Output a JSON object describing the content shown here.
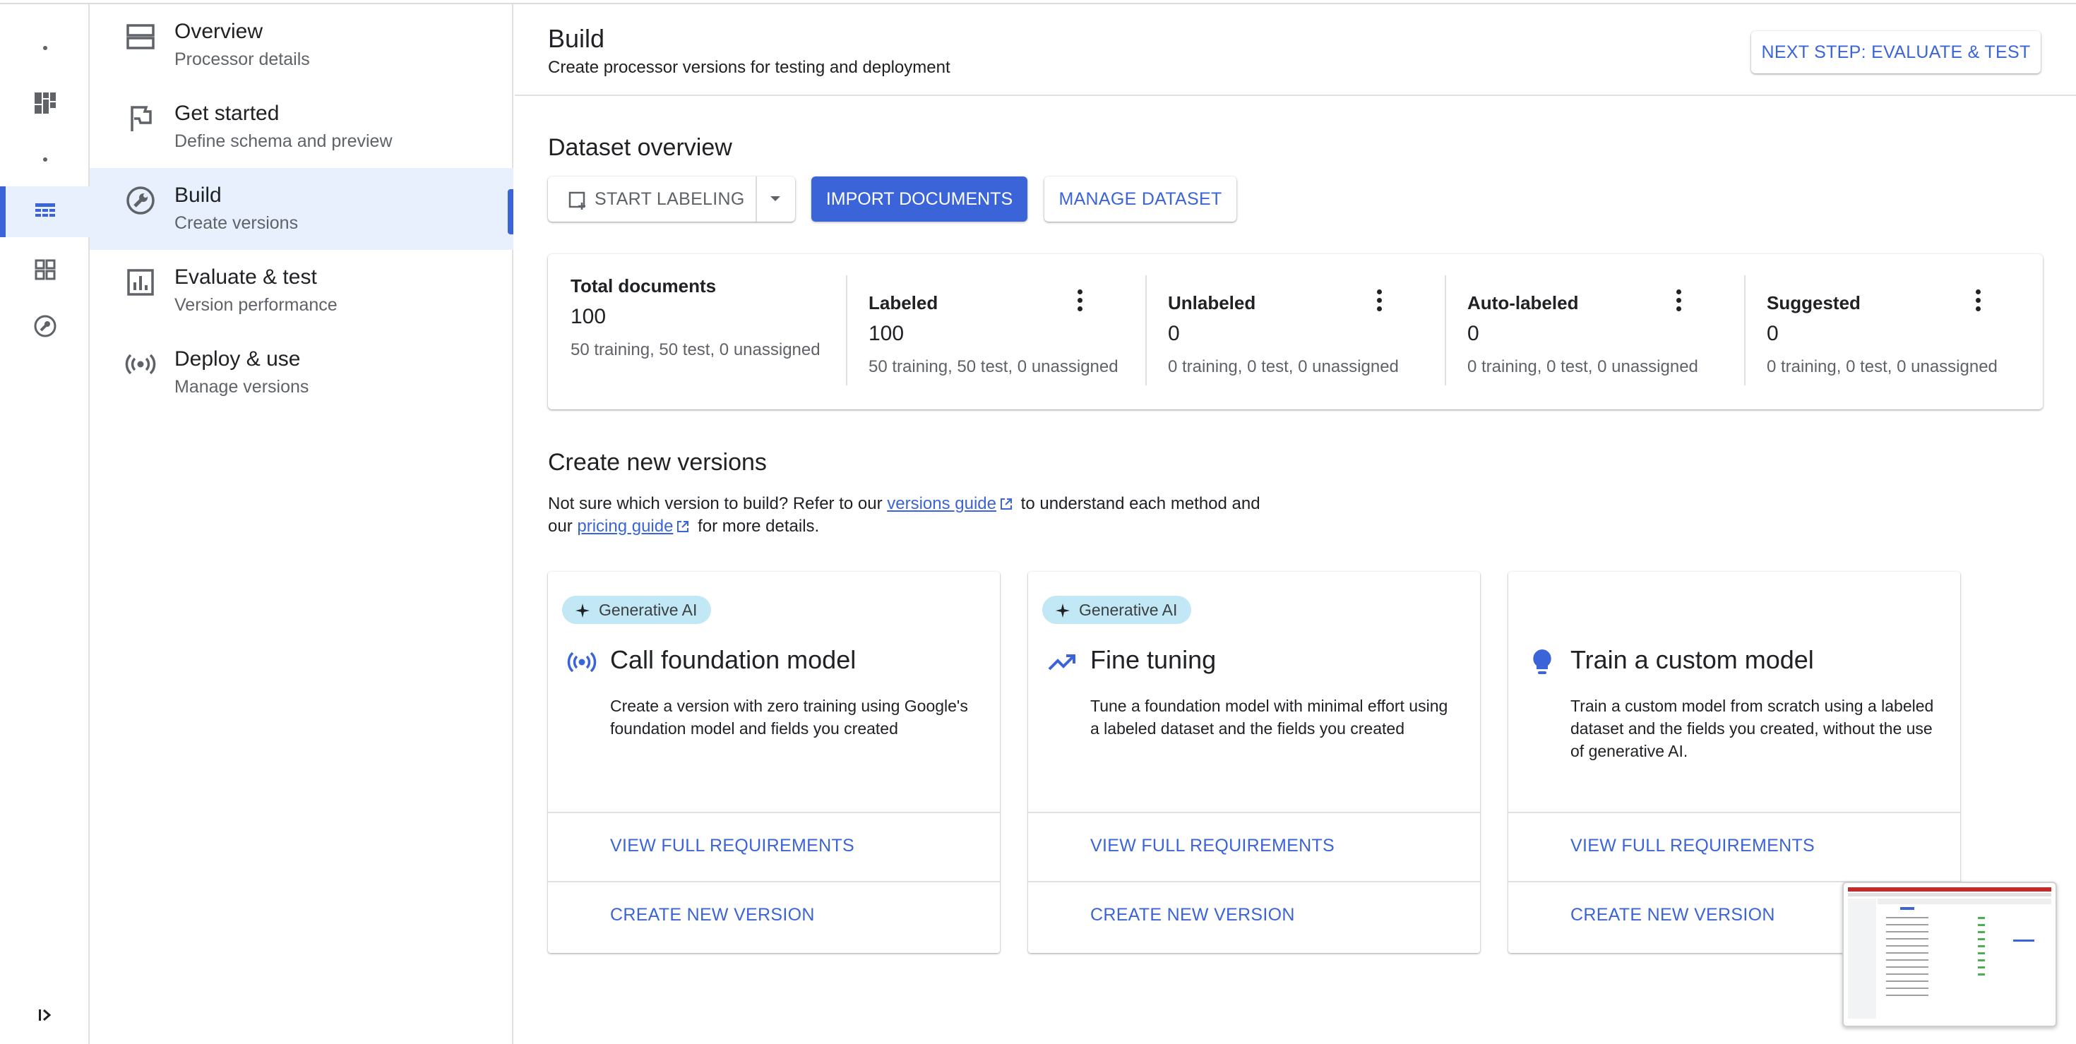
{
  "nav": {
    "items": [
      {
        "title": "Overview",
        "subtitle": "Processor details",
        "icon": "overview-icon"
      },
      {
        "title": "Get started",
        "subtitle": "Define schema and preview",
        "icon": "flag-icon"
      },
      {
        "title": "Build",
        "subtitle": "Create versions",
        "icon": "build-icon"
      },
      {
        "title": "Evaluate & test",
        "subtitle": "Version performance",
        "icon": "chart-icon"
      },
      {
        "title": "Deploy & use",
        "subtitle": "Manage versions",
        "icon": "broadcast-icon"
      }
    ]
  },
  "header": {
    "title": "Build",
    "subtitle": "Create processor versions for testing and deployment",
    "next_step": "NEXT STEP: EVALUATE & TEST"
  },
  "dataset": {
    "heading": "Dataset overview",
    "start_labeling": "START LABELING",
    "import_documents": "IMPORT DOCUMENTS",
    "manage_dataset": "MANAGE DATASET",
    "stats": [
      {
        "label": "Total documents",
        "value": "100",
        "detail": "50 training, 50 test, 0 unassigned"
      },
      {
        "label": "Labeled",
        "value": "100",
        "detail": "50 training, 50 test, 0 unassigned"
      },
      {
        "label": "Unlabeled",
        "value": "0",
        "detail": "0 training, 0 test, 0 unassigned"
      },
      {
        "label": "Auto-labeled",
        "value": "0",
        "detail": "0 training, 0 test, 0 unassigned"
      },
      {
        "label": "Suggested",
        "value": "0",
        "detail": "0 training, 0 test, 0 unassigned"
      }
    ]
  },
  "versions": {
    "heading": "Create new versions",
    "desc_part1": "Not sure which version to build? Refer to our ",
    "versions_guide": "versions guide",
    "desc_part2": " to understand each method and",
    "desc_part3": "our ",
    "pricing_guide": "pricing guide",
    "desc_part4": " for more details.",
    "cards": [
      {
        "chip": "Generative AI",
        "title": "Call foundation model",
        "description": "Create a version with zero training using Google's foundation model and fields you created",
        "requirements": "VIEW FULL REQUIREMENTS",
        "create": "CREATE NEW VERSION",
        "icon": "broadcast-icon"
      },
      {
        "chip": "Generative AI",
        "title": "Fine tuning",
        "description": "Tune a foundation model with minimal effort using a labeled dataset and the fields you created",
        "requirements": "VIEW FULL REQUIREMENTS",
        "create": "CREATE NEW VERSION",
        "icon": "trending-up-icon"
      },
      {
        "chip": "",
        "title": "Train a custom model",
        "description": "Train a custom model from scratch using a labeled dataset and the fields you created, without the use of generative AI.",
        "requirements": "VIEW FULL REQUIREMENTS",
        "create": "CREATE NEW VERSION",
        "icon": "lightbulb-icon"
      }
    ]
  },
  "colors": {
    "accent": "#3b64d8",
    "chip_bg": "#c2e7f5",
    "active_bg": "#e8f0fe"
  }
}
